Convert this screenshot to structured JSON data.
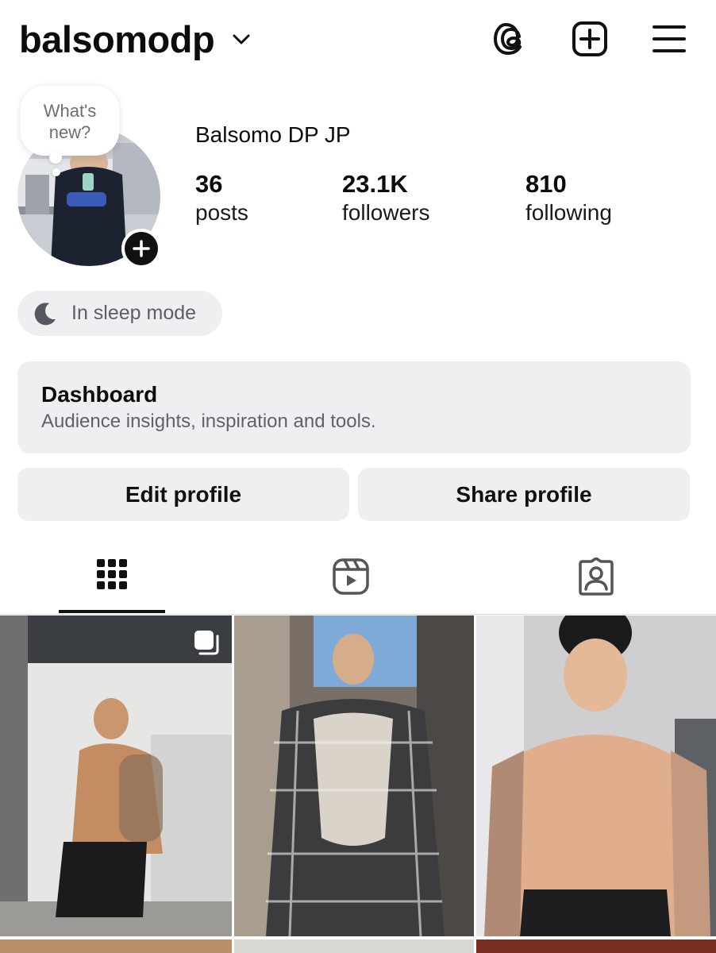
{
  "header": {
    "username": "balsomodp",
    "chevron_icon": "chevron-down-icon",
    "threads_icon": "threads-icon",
    "create_icon": "plus-square-icon",
    "menu_icon": "hamburger-menu-icon"
  },
  "note": {
    "text": "What's new?"
  },
  "profile": {
    "display_name": "Balsomo DP JP",
    "posts_count": "36",
    "posts_label": "posts",
    "followers_count": "23.1K",
    "followers_label": "followers",
    "following_count": "810",
    "following_label": "following"
  },
  "status": {
    "sleep_label": "In sleep mode"
  },
  "dashboard": {
    "title": "Dashboard",
    "subtitle": "Audience insights, inspiration and tools."
  },
  "buttons": {
    "edit_label": "Edit profile",
    "share_label": "Share profile"
  },
  "tabs": [
    {
      "name": "posts-grid",
      "icon": "grid-icon",
      "active": true
    },
    {
      "name": "reels",
      "icon": "reels-icon",
      "active": false
    },
    {
      "name": "tagged",
      "icon": "tagged-person-icon",
      "active": false
    }
  ],
  "colors": {
    "text": "#0c0c0c",
    "muted": "#5f6268",
    "card_bg": "#efeff2",
    "background": "#ffffff"
  }
}
